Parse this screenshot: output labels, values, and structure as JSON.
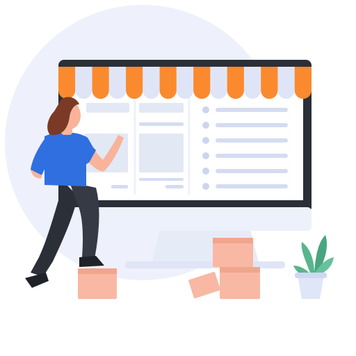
{
  "scene": {
    "subject": "online-storefront-illustration",
    "colors": {
      "background_circle": "#eef1fb",
      "monitor_frame": "#2b2f38",
      "screen": "#ffffff",
      "stand": "#e9edf8",
      "awning_orange": "#fb8a2e",
      "awning_light": "#dfe5f7",
      "placeholder_block": "#e3e8f5",
      "placeholder_line": "#d5dcf1",
      "list_dot": "#cdd5ee",
      "box": "#f8b8a4",
      "box_shade": "#f2a58d",
      "shirt": "#2f6fe0",
      "pants": "#31353d",
      "skin": "#f8b39a",
      "hair": "#7a3a26",
      "plant": "#59b58e",
      "pot": "#dfe6f8"
    },
    "icons": [
      "shop-awning-icon",
      "plant-icon",
      "shipping-box-icon"
    ]
  }
}
